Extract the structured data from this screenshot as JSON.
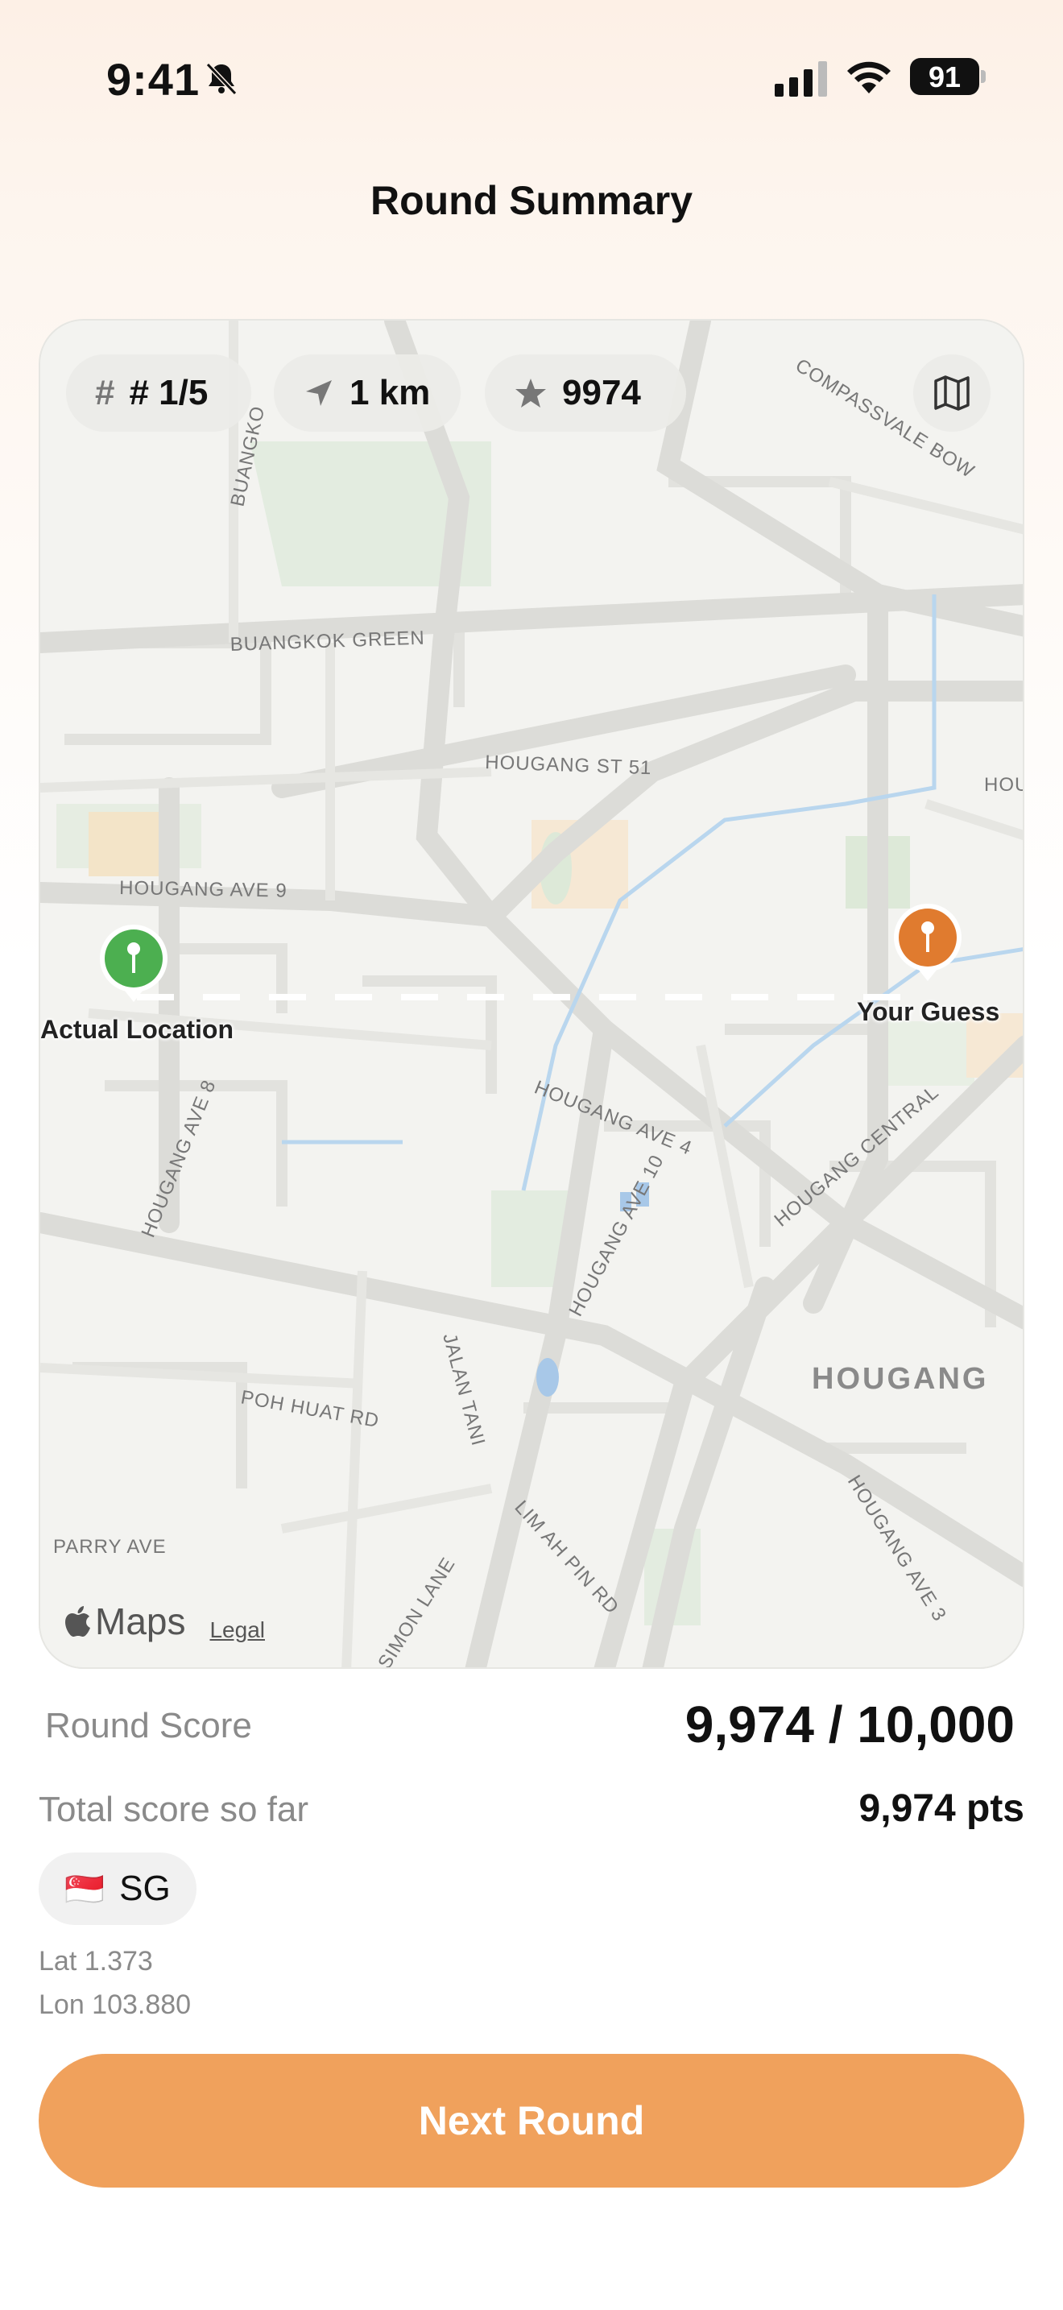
{
  "status_bar": {
    "time": "9:41",
    "battery": "91"
  },
  "header": {
    "title": "Round Summary"
  },
  "map": {
    "chips": {
      "round": "# 1/5",
      "distance": "1 km",
      "score": "9974"
    },
    "street_labels": {
      "buangko": "BUANGKO",
      "buangkok_green": "BUANGKOK GREEN",
      "compassvale_bow": "COMPASSVALE BOW",
      "hougang_st_51": "HOUGANG ST 51",
      "hougang_ave_9": "HOUGANG AVE 9",
      "hougang_ave_8": "HOUGANG AVE 8",
      "hougang_ave_4": "HOUGANG AVE 4",
      "hougang_ave_10": "HOUGANG AVE 10",
      "hougang_central": "HOUGANG CENTRAL",
      "hougang": "HOUGANG",
      "hougang_ave_3": "HOUGANG AVE 3",
      "poh_huat_rd": "POH HUAT RD",
      "jalan_tani": "JALAN TANI",
      "lim_ah_pin_rd": "LIM AH PIN RD",
      "parry_ave": "PARRY AVE",
      "simon_lane": "SIMON LANE",
      "hougang_edge": "HOUGA"
    },
    "actual_label": "Actual Location",
    "guess_label": "Your Guess",
    "attribution": {
      "brand": "Maps",
      "legal": "Legal"
    },
    "colors": {
      "actual_pin": "#4caf50",
      "guess_pin": "#e07b2f"
    }
  },
  "scores": {
    "round_label": "Round Score",
    "round_value": "9,974 / 10,000",
    "total_label": "Total score so far",
    "total_value": "9,974 pts"
  },
  "location": {
    "flag": "🇸🇬",
    "country_code": "SG",
    "lat": "Lat 1.373",
    "lon": "Lon 103.880"
  },
  "actions": {
    "next_label": "Next Round"
  },
  "colors": {
    "accent": "#f0a15c"
  }
}
